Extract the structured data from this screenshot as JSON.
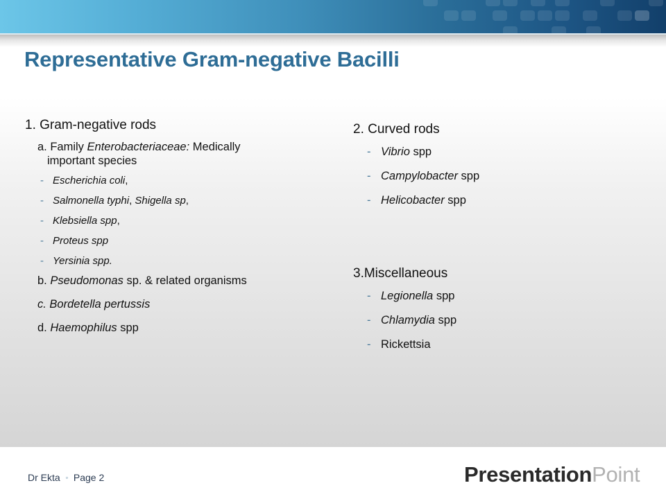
{
  "slide": {
    "title": "Representative Gram-negative Bacilli",
    "colors": {
      "title": "#2e6d96",
      "header_gradient_start": "#6cc6e8",
      "header_gradient_end": "#123f6a",
      "bullet_dash": "#4a7a9a"
    }
  },
  "left_column": {
    "heading": "1. Gram-negative rods",
    "a": {
      "prefix": "a. Family ",
      "italic": "Enterobacteriaceae:",
      "suffix": " Medically",
      "continuation": "important species"
    },
    "dash": "-",
    "species": [
      {
        "italic": "Escherichia coli",
        "plain": ","
      },
      {
        "italic": "Salmonella typhi",
        "plain": ", ",
        "italic2": "Shigella sp",
        "plain2": ","
      },
      {
        "italic": "Klebsiella spp",
        "plain": ","
      },
      {
        "italic": "Proteus spp",
        "plain": ""
      },
      {
        "italic": "Yersinia spp.",
        "plain": ""
      }
    ],
    "b": {
      "prefix": "b. ",
      "italic": "Pseudomonas",
      "suffix": " sp. & related organisms"
    },
    "c": {
      "prefix": "c. ",
      "italic": "Bordetella pertussis",
      "suffix": ""
    },
    "d": {
      "prefix": "d. ",
      "italic": "Haemophilus",
      "suffix": " spp"
    }
  },
  "right_column": {
    "section2": {
      "heading": "2. Curved rods",
      "items": [
        {
          "italic": "Vibrio",
          "plain": " spp"
        },
        {
          "italic": "Campylobacter",
          "plain": " spp"
        },
        {
          "italic": "Helicobacter",
          "plain": " spp"
        }
      ]
    },
    "section3": {
      "heading": "3.Miscellaneous",
      "items": [
        {
          "italic": "Legionella",
          "plain": " spp"
        },
        {
          "italic": "Chlamydia",
          "plain": " spp"
        },
        {
          "italic": "",
          "plain": "Rickettsia"
        }
      ]
    }
  },
  "footer": {
    "author": "Dr Ekta",
    "separator": "▫",
    "page": "Page 2",
    "logo_bold": "Presentation",
    "logo_light": "Point"
  }
}
